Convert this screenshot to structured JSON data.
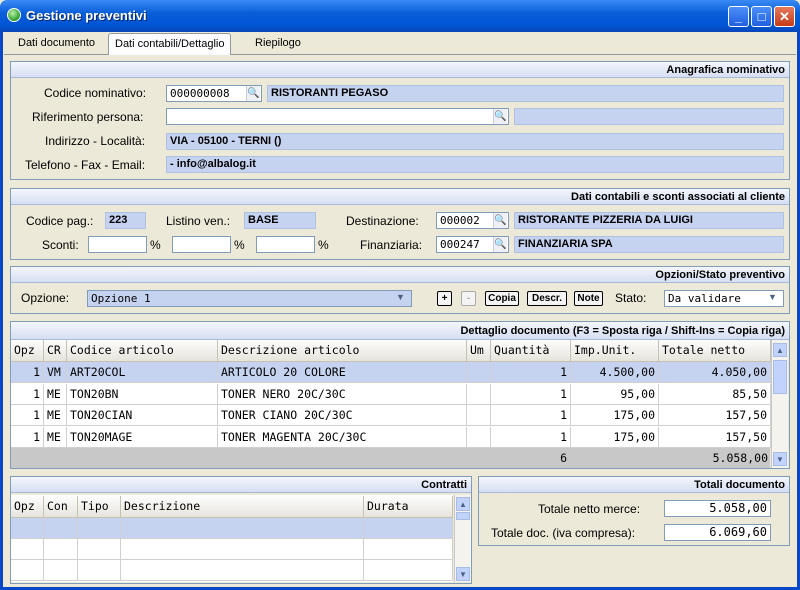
{
  "window": {
    "title": "Gestione preventivi"
  },
  "tabs": [
    {
      "label": "Dati documento"
    },
    {
      "label": "Dati contabili/Dettaglio"
    },
    {
      "label": "Riepilogo"
    }
  ],
  "anagrafica": {
    "header": "Anagrafica nominativo",
    "codice_label": "Codice nominativo:",
    "codice_value": "000000008",
    "codice_name": "RISTORANTI PEGASO",
    "riferimento_label": "Riferimento persona:",
    "riferimento_value": "",
    "riferimento_extra": "",
    "indirizzo_label": "Indirizzo - Località:",
    "indirizzo_value": "VIA - 05100 - TERNI ()",
    "contatti_label": "Telefono - Fax - Email:",
    "contatti_value": "- info@albalog.it"
  },
  "contabili": {
    "header": "Dati contabili e sconti associati al cliente",
    "codice_pag_label": "Codice pag.:",
    "codice_pag_value": "223",
    "listino_label": "Listino ven.:",
    "listino_value": "BASE",
    "destinazione_label": "Destinazione:",
    "destinazione_code": "000002",
    "destinazione_name": "RISTORANTE PIZZERIA DA LUIGI",
    "sconti_label": "Sconti:",
    "sconti": [
      "",
      "",
      ""
    ],
    "percent": "%",
    "finanziaria_label": "Finanziaria:",
    "finanziaria_code": "000247",
    "finanziaria_name": "FINANZIARIA SPA"
  },
  "opzioni": {
    "header": "Opzioni/Stato preventivo",
    "opzione_label": "Opzione:",
    "opzione_value": "Opzione 1",
    "add": "+",
    "remove": "-",
    "copia": "Copia",
    "descr": "Descr.",
    "note": "Note",
    "stato_label": "Stato:",
    "stato_value": "Da validare"
  },
  "dettaglio": {
    "header": "Dettaglio documento (F3 = Sposta riga / Shift-Ins = Copia riga)",
    "columns": [
      "Opz",
      "CR",
      "Codice articolo",
      "Descrizione articolo",
      "Um",
      "Quantità",
      "Imp.Unit.",
      "Totale netto"
    ],
    "rows": [
      [
        "1",
        "VM",
        "ART20COL",
        "ARTICOLO 20 COLORE",
        "",
        "1",
        "4.500,00",
        "4.050,00"
      ],
      [
        "1",
        "ME",
        "TON20BN",
        "TONER NERO 20C/30C",
        "",
        "1",
        "95,00",
        "85,50"
      ],
      [
        "1",
        "ME",
        "TON20CIAN",
        "TONER CIANO 20C/30C",
        "",
        "1",
        "175,00",
        "157,50"
      ],
      [
        "1",
        "ME",
        "TON20MAGE",
        "TONER MAGENTA 20C/30C",
        "",
        "1",
        "175,00",
        "157,50"
      ]
    ],
    "total_qty": "6",
    "total_net": "5.058,00"
  },
  "contratti": {
    "header": "Contratti",
    "columns": [
      "Opz",
      "Con",
      "Tipo",
      "Descrizione",
      "Durata"
    ]
  },
  "totali": {
    "header": "Totali documento",
    "merce_label": "Totale netto merce:",
    "merce_value": "5.058,00",
    "doc_label": "Totale doc. (iva compresa):",
    "doc_value": "6.069,60"
  }
}
